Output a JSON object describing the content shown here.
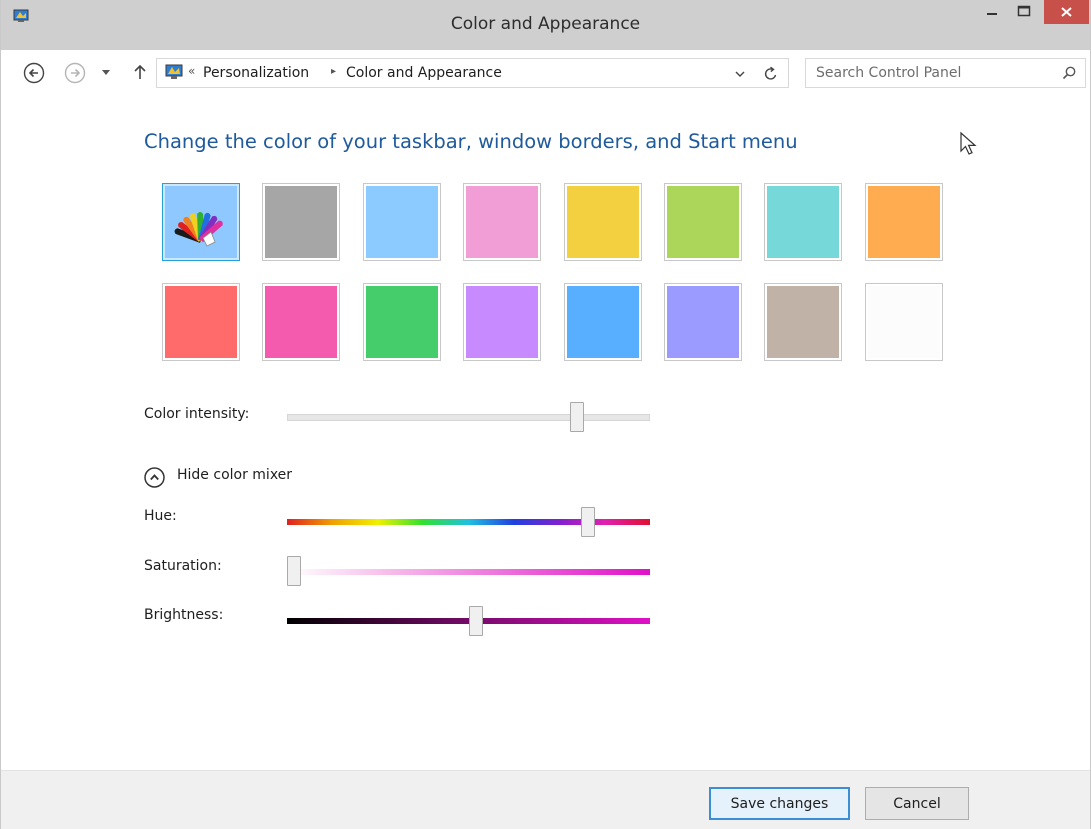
{
  "window": {
    "title": "Color and Appearance"
  },
  "navigation": {
    "breadcrumb_overflow": "«",
    "breadcrumb_separator": "▸",
    "breadcrumbs": [
      "Personalization",
      "Color and Appearance"
    ],
    "search_placeholder": "Search Control Panel"
  },
  "content": {
    "heading": "Change the color of your taskbar, window borders, and Start menu",
    "swatches": [
      {
        "color": "#8ec8ff",
        "kind": "automatic",
        "selected": true
      },
      {
        "color": "#a6a6a6",
        "selected": false
      },
      {
        "color": "#8ccbff",
        "selected": false
      },
      {
        "color": "#f29ed6",
        "selected": false
      },
      {
        "color": "#f2d040",
        "selected": false
      },
      {
        "color": "#acd65a",
        "selected": false
      },
      {
        "color": "#76d8d8",
        "selected": false
      },
      {
        "color": "#ffab50",
        "selected": false
      },
      {
        "color": "#ff6b6b",
        "selected": false
      },
      {
        "color": "#f45aae",
        "selected": false
      },
      {
        "color": "#45cd6c",
        "selected": false
      },
      {
        "color": "#c78aff",
        "selected": false
      },
      {
        "color": "#58aeff",
        "selected": false
      },
      {
        "color": "#9a9aff",
        "selected": false
      },
      {
        "color": "#c0b2a6",
        "selected": false
      },
      {
        "color": "#fcfcfc",
        "selected": false
      }
    ],
    "color_intensity": {
      "label": "Color intensity:",
      "value": 0.8
    },
    "mixer_toggle_label": "Hide color mixer",
    "hue": {
      "label": "Hue:",
      "value": 0.83
    },
    "saturation": {
      "label": "Saturation:",
      "value": 0.02
    },
    "brightness": {
      "label": "Brightness:",
      "value": 0.52
    }
  },
  "footer": {
    "save_label": "Save changes",
    "cancel_label": "Cancel"
  },
  "colors": {
    "heading": "#1e5a9c",
    "close_button": "#c7504a",
    "mixer_end": "#e010c8"
  }
}
